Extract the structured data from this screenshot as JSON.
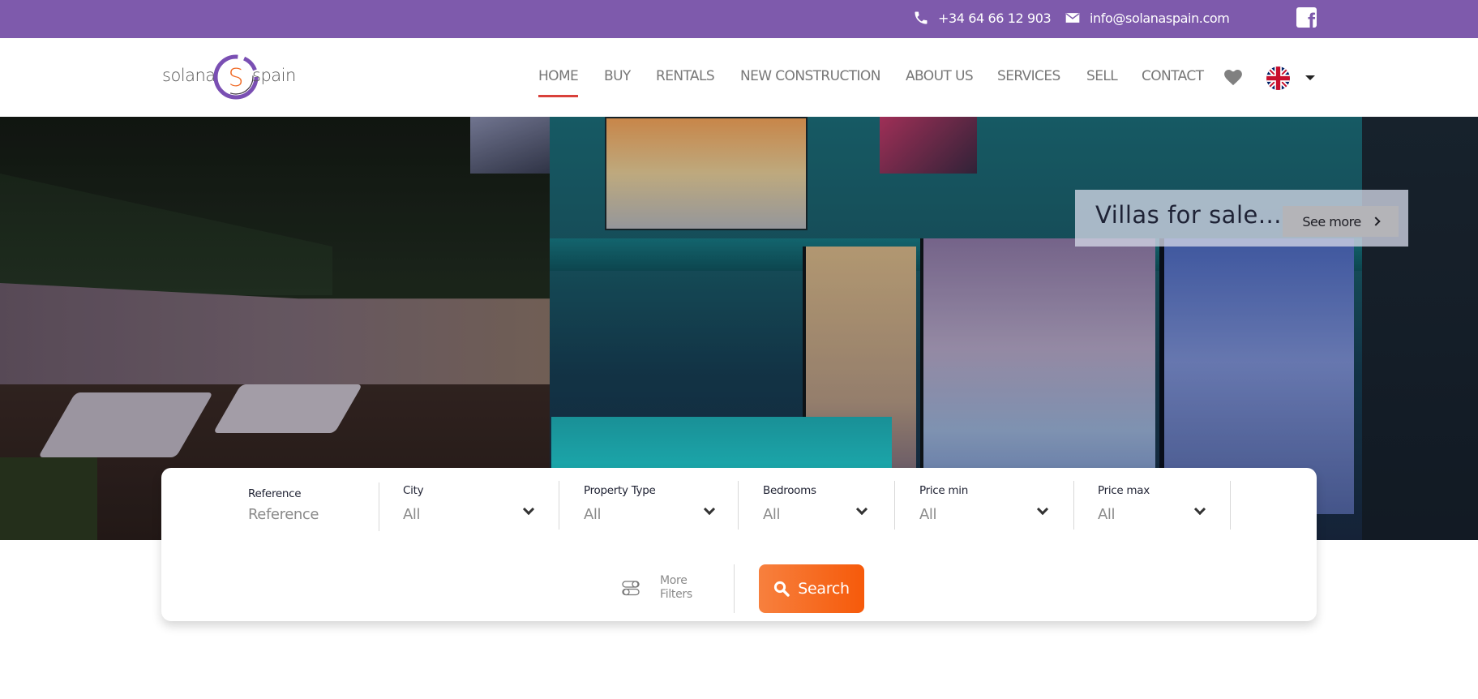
{
  "topbar": {
    "phone": "+34 64 66 12 903",
    "email": "info@solanaspain.com",
    "icons": {
      "phone": "phone-icon",
      "email": "envelope-icon",
      "social": "facebook-icon"
    },
    "background_color": "#7e5aac"
  },
  "header": {
    "logo": {
      "left_word": "solana",
      "middle_letter": "S",
      "right_word": "spain"
    },
    "nav": [
      {
        "label": "HOME",
        "active": true
      },
      {
        "label": "BUY",
        "active": false
      },
      {
        "label": "RENTALS",
        "active": false
      },
      {
        "label": "NEW CONSTRUCTION",
        "active": false
      },
      {
        "label": "ABOUT US",
        "active": false
      },
      {
        "label": "SERVICES",
        "active": false
      },
      {
        "label": "SELL",
        "active": false
      },
      {
        "label": "CONTACT",
        "active": false
      }
    ],
    "favorites_icon": "heart-icon",
    "language": {
      "flag": "uk-flag-icon",
      "dropdown_icon": "caret-down-icon"
    },
    "active_underline_color": "#d9413b"
  },
  "hero": {
    "promo": {
      "title": "Villas for sale...",
      "button_label": "See more"
    }
  },
  "search": {
    "fields": [
      {
        "label": "Reference",
        "placeholder": "Reference",
        "type": "input"
      },
      {
        "label": "City",
        "value": "All",
        "type": "select"
      },
      {
        "label": "Property Type",
        "value": "All",
        "type": "select"
      },
      {
        "label": "Bedrooms",
        "value": "All",
        "type": "select"
      },
      {
        "label": "Price min",
        "value": "All",
        "type": "select"
      },
      {
        "label": "Price max",
        "value": "All",
        "type": "select"
      }
    ],
    "more_filters": {
      "line1": "More",
      "line2": "Filters"
    },
    "search_button": "Search",
    "button_color": "#f65a0a"
  }
}
